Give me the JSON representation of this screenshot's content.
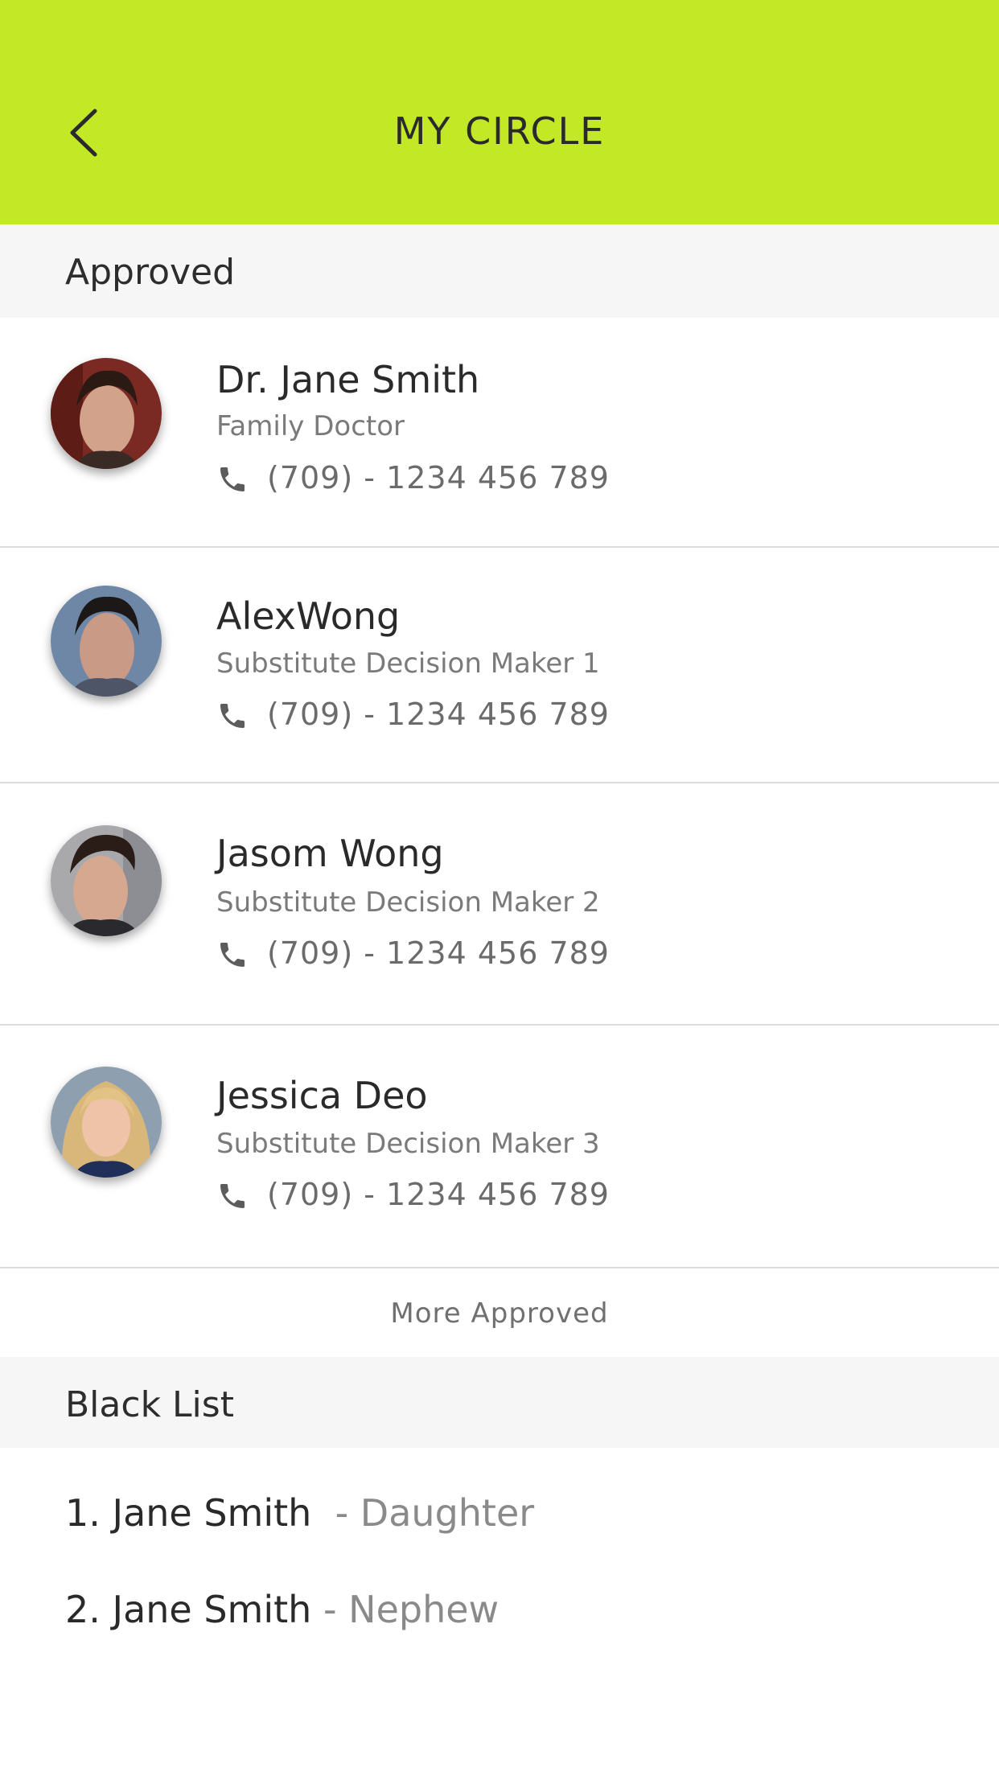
{
  "header": {
    "title": "MY CIRCLE",
    "back_icon": "chevron-left-icon",
    "bg_color": "#c3e825"
  },
  "approved": {
    "heading": "Approved",
    "contacts": [
      {
        "name": "Dr. Jane Smith",
        "role": "Family Doctor",
        "phone": "(709) - 1234 456 789"
      },
      {
        "name": "AlexWong",
        "role": "Substitute Decision Maker 1",
        "phone": "(709) - 1234 456 789"
      },
      {
        "name": "Jasom Wong",
        "role": "Substitute Decision Maker 2",
        "phone": "(709) - 1234 456 789"
      },
      {
        "name": "Jessica Deo",
        "role": "Substitute Decision Maker 3",
        "phone": "(709) - 1234 456 789"
      }
    ],
    "more_label": "More Approved"
  },
  "blacklist": {
    "heading": "Black List",
    "items": [
      {
        "name": "1. Jane Smith",
        "relation": "- Daughter"
      },
      {
        "name": "2. Jane Smith",
        "relation": "- Nephew"
      }
    ]
  }
}
